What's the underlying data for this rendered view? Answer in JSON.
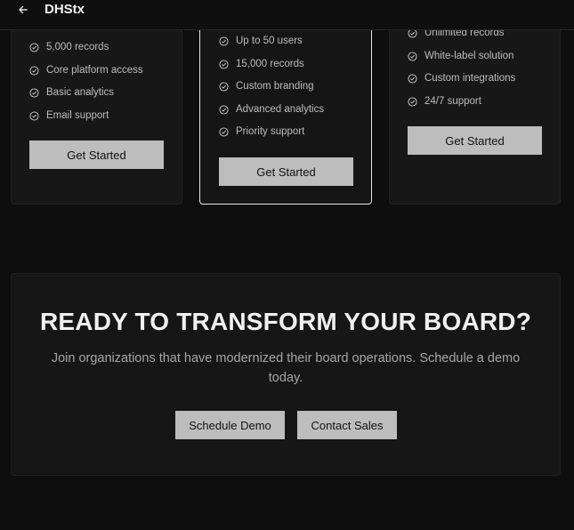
{
  "header": {
    "title": "DHStx",
    "back_icon": "arrow-left-icon"
  },
  "plans": [
    {
      "features": [
        "5,000 records",
        "Core platform access",
        "Basic analytics",
        "Email support"
      ],
      "button_label": "Get Started"
    },
    {
      "featured": true,
      "features": [
        "Up to 50 users",
        "15,000 records",
        "Custom branding",
        "Advanced analytics",
        "Priority support"
      ],
      "button_label": "Get Started"
    },
    {
      "features": [
        "Unlimited records",
        "White-label solution",
        "Custom integrations",
        "24/7 support"
      ],
      "button_label": "Get Started"
    }
  ],
  "cta": {
    "title": "READY TO TRANSFORM YOUR BOARD?",
    "subtitle": "Join organizations that have modernized their board operations. Schedule a demo today.",
    "primary_label": "Schedule Demo",
    "secondary_label": "Contact Sales"
  },
  "colors": {
    "background": "#0e0e0e",
    "card": "#171717",
    "button": "#bdbdbd",
    "featured_border": "#e6e6e6"
  }
}
